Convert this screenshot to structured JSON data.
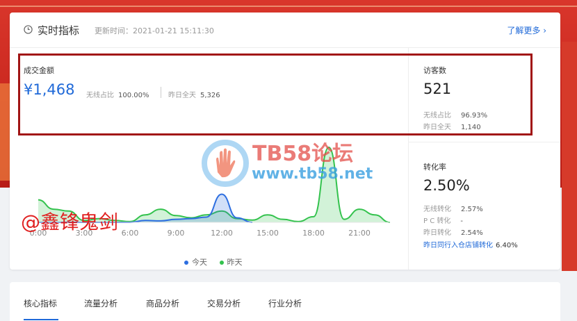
{
  "header": {
    "title": "实时指标",
    "updated": "更新时间：2021-01-21 15:11:30",
    "more": "了解更多 ›"
  },
  "gmv": {
    "label": "成交金额",
    "value": "¥1,468",
    "wireless_label": "无线占比",
    "wireless_value": "100.00%",
    "yesterday_label": "昨日全天",
    "yesterday_value": "5,326"
  },
  "visitors": {
    "label": "访客数",
    "value": "521",
    "wireless_label": "无线占比",
    "wireless_value": "96.93%",
    "yesterday_label": "昨日全天",
    "yesterday_value": "1,140"
  },
  "conversion": {
    "label": "转化率",
    "value": "2.50%",
    "wireless_label": "无线转化",
    "wireless_value": "2.57%",
    "pc_label": "P C 转化",
    "pc_value": "-",
    "yesterday_label": "昨日转化",
    "yesterday_value": "2.54%",
    "peer_label": "昨日同行入仓店铺转化",
    "peer_value": "6.40%"
  },
  "chart_data": {
    "type": "area",
    "x_ticks": [
      "0:00",
      "3:00",
      "6:00",
      "9:00",
      "12:00",
      "15:00",
      "18:00",
      "21:00"
    ],
    "hours": [
      0,
      1,
      2,
      3,
      4,
      5,
      6,
      7,
      8,
      9,
      10,
      11,
      12,
      13,
      14,
      15,
      16,
      17,
      18,
      19,
      20,
      21,
      22,
      23
    ],
    "series": [
      {
        "name": "今天",
        "color": "#2d6ee0",
        "values": [
          0,
          0,
          0,
          0,
          0,
          0,
          0,
          5,
          4,
          8,
          10,
          14,
          75,
          12,
          0,
          null,
          null,
          null,
          null,
          null,
          null,
          null,
          null,
          null
        ]
      },
      {
        "name": "昨天",
        "color": "#33c24d",
        "values": [
          60,
          35,
          30,
          5,
          10,
          5,
          2,
          20,
          35,
          18,
          12,
          20,
          30,
          10,
          6,
          20,
          8,
          2,
          15,
          200,
          8,
          35,
          20,
          0
        ]
      }
    ]
  },
  "legend": {
    "today": "今天",
    "yesterday": "昨天",
    "today_color": "#2d6ee0",
    "yesterday_color": "#33c24d"
  },
  "watermark": {
    "forum_name": "TB58论坛",
    "forum_url": "www.tb58.net",
    "author": "@鑫锋鬼剑"
  },
  "tabs": [
    "核心指标",
    "流量分析",
    "商品分析",
    "交易分析",
    "行业分析"
  ]
}
